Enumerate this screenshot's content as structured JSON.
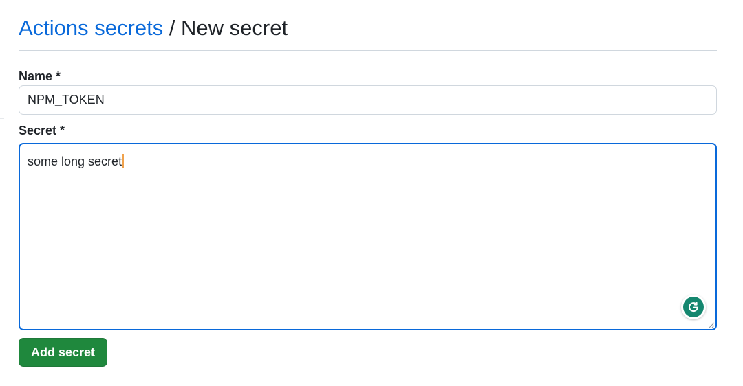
{
  "breadcrumb": {
    "parent_label": "Actions secrets",
    "separator": " / ",
    "current_label": "New secret"
  },
  "form": {
    "name_label": "Name *",
    "name_value": "NPM_TOKEN",
    "secret_label": "Secret *",
    "secret_value": "some long secret",
    "submit_label": "Add secret"
  },
  "icons": {
    "grammarly": "grammarly-icon",
    "resize": "resize-handle-icon"
  },
  "colors": {
    "link": "#0969da",
    "focus_border": "#0969da",
    "primary_button": "#1f883d",
    "grammarly": "#15876f"
  }
}
